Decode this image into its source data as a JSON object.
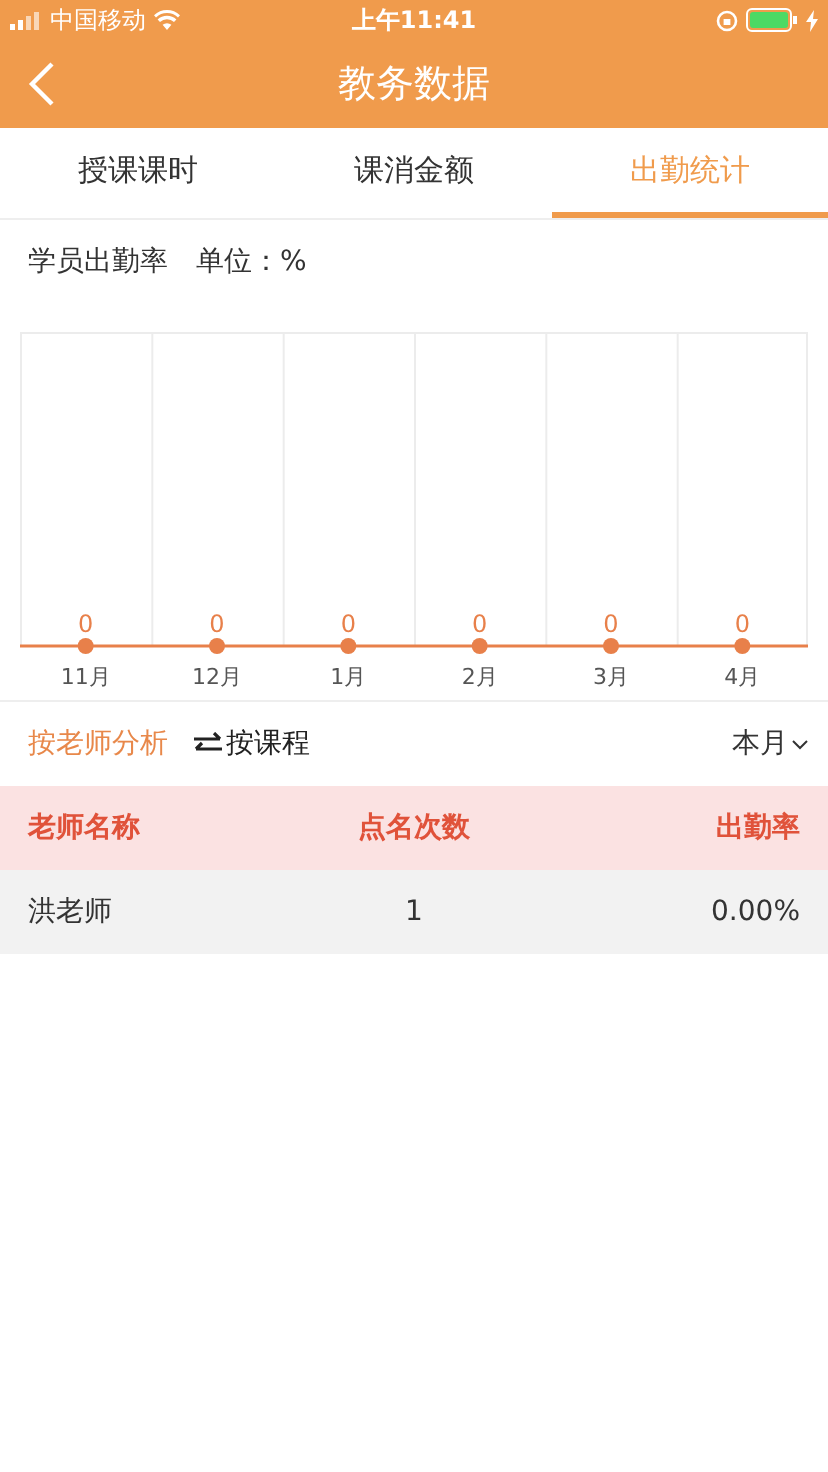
{
  "status_bar": {
    "carrier": "中国移动",
    "time": "上午11:41"
  },
  "header": {
    "title": "教务数据"
  },
  "tabs": [
    {
      "label": "授课课时",
      "selected": false
    },
    {
      "label": "课消金额",
      "selected": false
    },
    {
      "label": "出勤统计",
      "selected": true
    }
  ],
  "chart_heading": {
    "title": "学员出勤率",
    "unit": "单位：%"
  },
  "chart": {
    "months": [
      "11月",
      "12月",
      "1月",
      "2月",
      "3月",
      "4月"
    ],
    "point_labels": [
      "0",
      "0",
      "0",
      "0",
      "0",
      "0"
    ]
  },
  "filters": [
    {
      "label": "按老师分析",
      "selected": true,
      "kind": "text"
    },
    {
      "label": "按课程",
      "selected": false,
      "kind": "swap"
    }
  ],
  "period": {
    "label": "本月"
  },
  "table": {
    "columns": [
      "老师名称",
      "点名次数",
      "出勤率"
    ],
    "rows": [
      [
        "洪老师",
        "1",
        "0.00%"
      ]
    ]
  }
}
